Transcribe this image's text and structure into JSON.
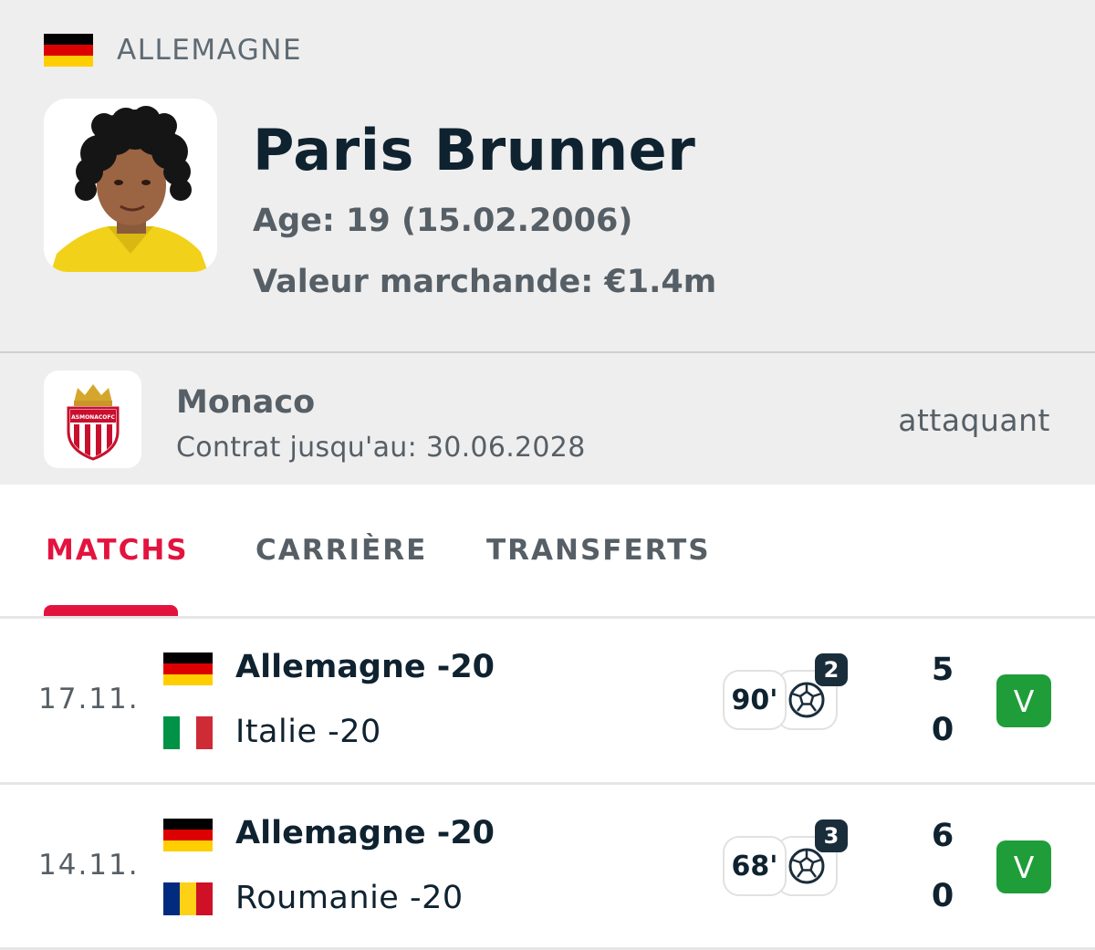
{
  "player": {
    "nationality": "ALLEMAGNE",
    "name": "Paris Brunner",
    "age_line": "Age: 19 (15.02.2006)",
    "market_value_line": "Valeur marchande: €1.4m"
  },
  "club": {
    "name": "Monaco",
    "contract_line": "Contrat jusqu'au: 30.06.2028",
    "position": "attaquant",
    "logo_text": "ASMONACOFC"
  },
  "tabs": [
    {
      "label": "MATCHS",
      "active": true
    },
    {
      "label": "CARRIÈRE",
      "active": false
    },
    {
      "label": "TRANSFERTS",
      "active": false
    }
  ],
  "matches": [
    {
      "date": "17.11.",
      "home": {
        "name": "Allemagne -20",
        "flag": "germany-flag"
      },
      "away": {
        "name": "Italie -20",
        "flag": "italy-flag"
      },
      "minutes": "90'",
      "goals": "2",
      "score_home": "5",
      "score_away": "0",
      "result": "V"
    },
    {
      "date": "14.11.",
      "home": {
        "name": "Allemagne -20",
        "flag": "germany-flag"
      },
      "away": {
        "name": "Roumanie -20",
        "flag": "romania-flag"
      },
      "minutes": "68'",
      "goals": "3",
      "score_home": "6",
      "score_away": "0",
      "result": "V"
    }
  ],
  "colors": {
    "accent": "#e3133f",
    "win": "#1f9d39",
    "header_bg": "#eeeeee",
    "text_dark": "#0f2230",
    "text_muted": "#565f66"
  }
}
